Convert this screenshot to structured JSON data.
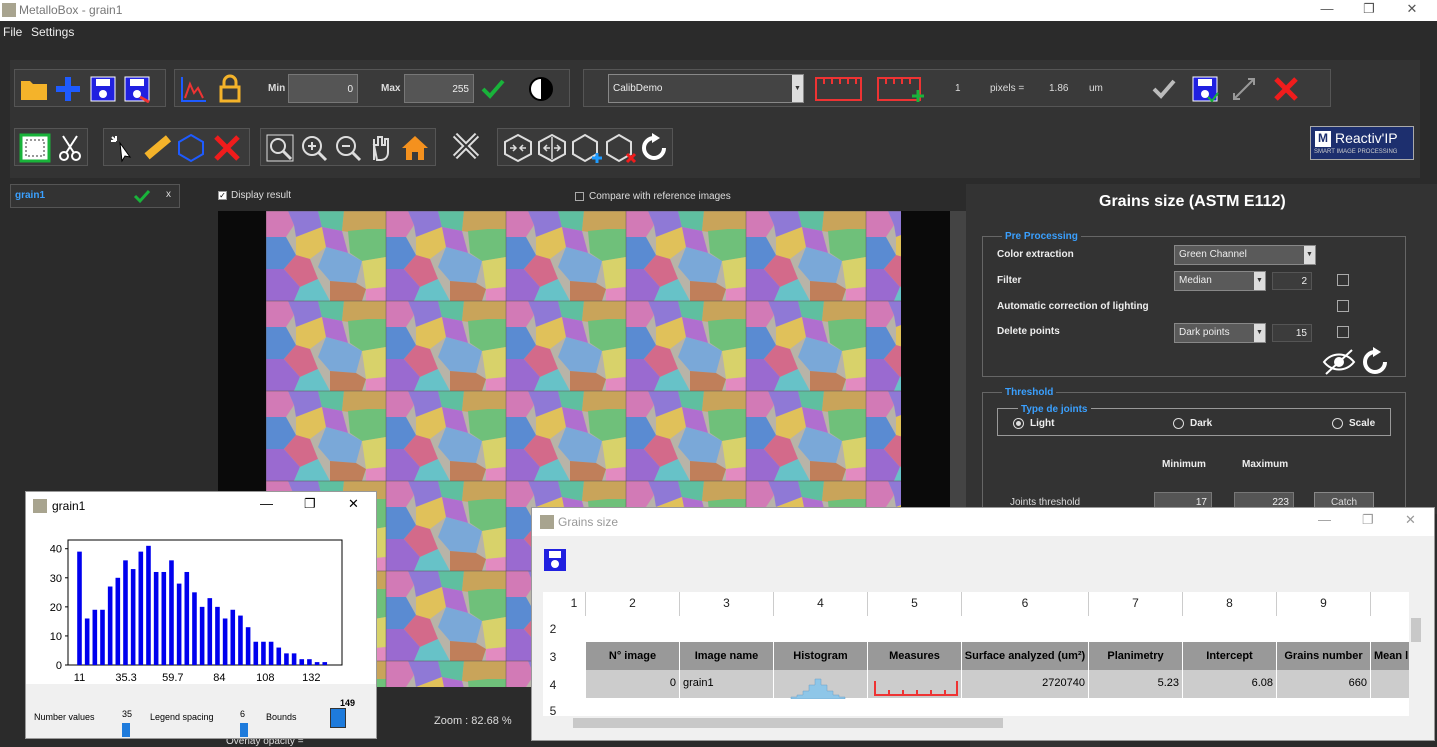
{
  "window": {
    "title": "MetalloBox - grain1",
    "minimize": "—",
    "maximize": "❐",
    "close": "✕"
  },
  "menu": {
    "file": "File",
    "settings": "Settings"
  },
  "toolbar": {
    "min_label": "Min",
    "min_value": "0",
    "max_label": "Max",
    "max_value": "255",
    "calib_select": "CalibDemo",
    "calib_count": "1",
    "pixels_label": "pixels =",
    "pixels_value": "1.86",
    "unit": "um"
  },
  "brand": {
    "name": "Reactiv'IP",
    "tagline": "SMART IMAGE PROCESSING",
    "mark": "M"
  },
  "left": {
    "image_tab": "grain1",
    "close": "x"
  },
  "view": {
    "display_result": "Display result",
    "compare": "Compare with reference images",
    "zoom": "Zoom : 82.68 %",
    "overlay": "Overlay opacity ="
  },
  "panel": {
    "title": "Grains size (ASTM E112)",
    "preprocessing": {
      "title": "Pre Processing",
      "color_extraction_label": "Color extraction",
      "color_extraction_value": "Green Channel",
      "filter_label": "Filter",
      "filter_value": "Median",
      "filter_size": "2",
      "auto_lighting_label": "Automatic correction of lighting",
      "delete_points_label": "Delete points",
      "delete_points_value": "Dark points",
      "delete_points_size": "15"
    },
    "threshold": {
      "title": "Threshold",
      "joints_group": "Type de joints",
      "light": "Light",
      "dark": "Dark",
      "scale": "Scale",
      "minimum": "Minimum",
      "maximum": "Maximum",
      "joints_threshold": "Joints threshold",
      "min_value": "17",
      "max_value": "223",
      "catch": "Catch"
    }
  },
  "hist": {
    "title": "grain1",
    "footer": {
      "number_values_label": "Number values",
      "number_values": "35",
      "legend_spacing_label": "Legend spacing",
      "legend_spacing": "6",
      "bounds_label": "Bounds",
      "bounds_value": "149"
    }
  },
  "table": {
    "title": "Grains size",
    "col_numbers": [
      "1",
      "2",
      "3",
      "4",
      "5",
      "6",
      "7",
      "8",
      "9"
    ],
    "row_numbers": [
      "2",
      "3",
      "4",
      "5"
    ],
    "headers": [
      "N° image",
      "Image name",
      "Histogram",
      "Measures",
      "Surface analyzed (um²)",
      "Planimetry",
      "Intercept",
      "Grains number",
      "Mean l"
    ],
    "row": {
      "n_image": "0",
      "image_name": "grain1",
      "surface": "2720740",
      "planimetry": "5.23",
      "intercept": "6.08",
      "grains_number": "660"
    }
  },
  "chart_data": {
    "type": "bar",
    "title": "",
    "xlabel": "",
    "ylabel": "",
    "ylim": [
      0,
      43
    ],
    "xlim": [
      5,
      148
    ],
    "x_ticks": [
      11,
      35.3,
      59.7,
      84,
      108,
      132
    ],
    "y_ticks": [
      0,
      10,
      20,
      30,
      40
    ],
    "color": "#0000ee",
    "x": [
      11,
      15,
      19,
      23,
      27,
      31,
      35,
      39,
      43,
      47,
      51,
      55,
      59,
      63,
      67,
      71,
      75,
      79,
      83,
      87,
      91,
      95,
      99,
      103,
      107,
      111,
      115,
      119,
      123,
      127,
      131,
      135,
      139
    ],
    "values": [
      39,
      16,
      19,
      19,
      27,
      30,
      36,
      33,
      39,
      41,
      32,
      32,
      36,
      28,
      32,
      25,
      20,
      23,
      20,
      16,
      19,
      17,
      13,
      8,
      8,
      8,
      6,
      4,
      4,
      2,
      2,
      1,
      1
    ]
  }
}
